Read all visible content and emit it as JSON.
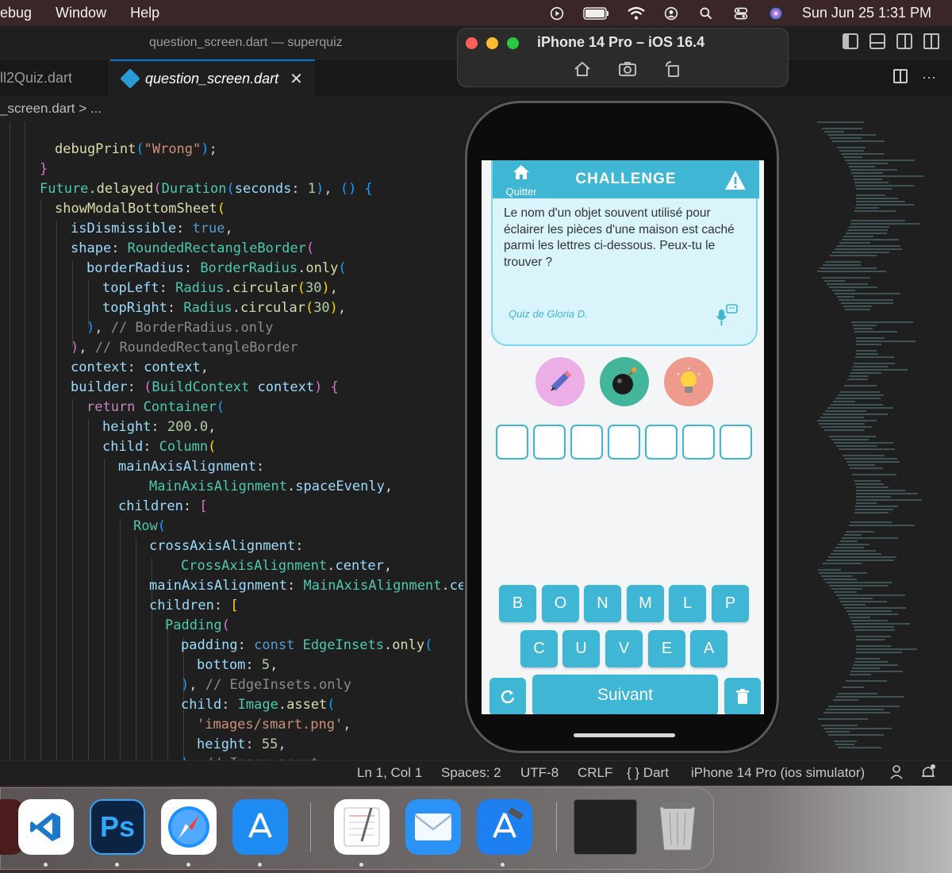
{
  "menubar": {
    "items": [
      "ebug",
      "Window",
      "Help"
    ],
    "datetime": "Sun Jun 25  1:31 PM"
  },
  "window": {
    "title": "question_screen.dart — superquiz"
  },
  "tabs": [
    {
      "label": "ll2Quiz.dart"
    },
    {
      "label": "question_screen.dart"
    }
  ],
  "breadcrumb": "_screen.dart > ...",
  "code": [
    [
      "debugPrint(\"Wrong\");"
    ],
    [
      "}"
    ],
    [
      "Future.delayed(Duration(seconds: 1), () {"
    ],
    [
      "showModalBottomSheet("
    ],
    [
      "isDismissible: true,"
    ],
    [
      "shape: RoundedRectangleBorder("
    ],
    [
      "borderRadius: BorderRadius.only("
    ],
    [
      "topLeft: Radius.circular(30),"
    ],
    [
      "topRight: Radius.circular(30),"
    ],
    [
      "), // BorderRadius.only"
    ],
    [
      "), // RoundedRectangleBorder"
    ],
    [
      "context: context,"
    ],
    [
      "builder: (BuildContext context) {"
    ],
    [
      "return Container("
    ],
    [
      "height: 200.0,"
    ],
    [
      "child: Column("
    ],
    [
      "mainAxisAlignment:"
    ],
    [
      "MainAxisAlignment.spaceEvenly,"
    ],
    [
      "children: ["
    ],
    [
      "Row("
    ],
    [
      "crossAxisAlignment:"
    ],
    [
      "CrossAxisAlignment.center,"
    ],
    [
      "mainAxisAlignment: MainAxisAlignment.cen"
    ],
    [
      "children: ["
    ],
    [
      "Padding("
    ],
    [
      "padding: const EdgeInsets.only("
    ],
    [
      "bottom: 5,"
    ],
    [
      "), // EdgeInsets.only"
    ],
    [
      "child: Image.asset("
    ],
    [
      "'images/smart.png',"
    ],
    [
      "height: 55,"
    ],
    [
      "), // Image.asset"
    ]
  ],
  "statusbar": {
    "position": "Ln 1, Col 1",
    "spaces": "Spaces: 2",
    "encoding": "UTF-8",
    "eol": "CRLF",
    "language": "{ } Dart",
    "device": "iPhone 14 Pro (ios simulator)"
  },
  "simulator": {
    "title": "iPhone 14 Pro – iOS 16.4"
  },
  "app": {
    "home_label": "Quitter",
    "header_title": "CHALLENGE",
    "question": "Le nom d'un objet souvent utilisé pour éclairer les pièces d'une maison est caché parmi les lettres ci-dessous. Peux-tu le trouver ?",
    "author": "Quiz de Gloria D.",
    "slots": 7,
    "keys_row1": [
      "B",
      "O",
      "N",
      "M",
      "L",
      "P"
    ],
    "keys_row2": [
      "C",
      "U",
      "V",
      "E",
      "A"
    ],
    "next_label": "Suivant",
    "colors": {
      "accent": "#3fb6d3",
      "card": "#d9f5fb"
    },
    "powerups": [
      "pencil-icon",
      "bomb-icon",
      "lightbulb-icon"
    ]
  },
  "dock": [
    "vscode-icon",
    "photoshop-icon",
    "safari-icon",
    "app-store-icon",
    "textedit-icon",
    "mail-icon",
    "xcode-icon",
    "window-preview",
    "trash-icon"
  ]
}
